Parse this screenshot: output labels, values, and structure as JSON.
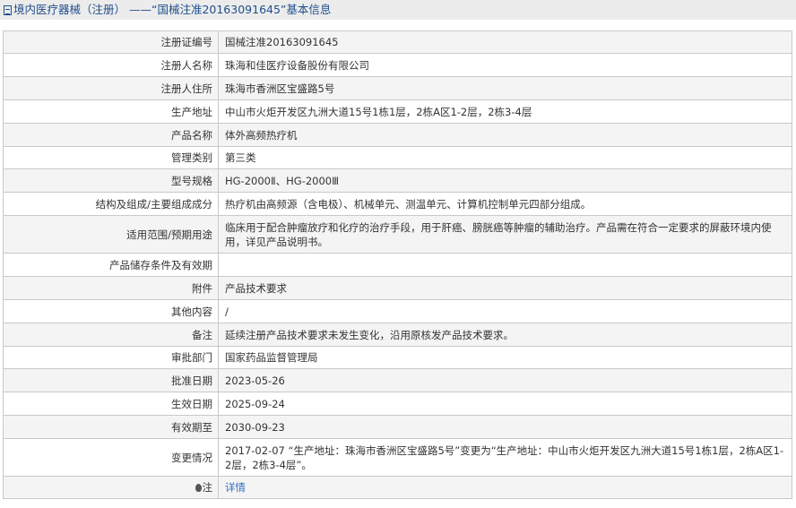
{
  "header": {
    "title": "境内医疗器械（注册）  ——“国械注准20163091645”基本信息"
  },
  "rows": [
    {
      "label": "注册证编号",
      "value": "国械注准20163091645",
      "h": 24
    },
    {
      "label": "注册人名称",
      "value": "珠海和佳医疗设备股份有限公司",
      "h": 26
    },
    {
      "label": "注册人住所",
      "value": "珠海市香洲区宝盛路5号",
      "h": 26
    },
    {
      "label": "生产地址",
      "value": "中山市火炬开发区九洲大道15号1栋1层，2栋A区1-2层，2栋3-4层",
      "h": 26
    },
    {
      "label": "产品名称",
      "value": "体外高频热疗机",
      "h": 26
    },
    {
      "label": "管理类别",
      "value": "第三类",
      "h": 24
    },
    {
      "label": "型号规格",
      "value": "HG-2000Ⅱ、HG-2000Ⅲ",
      "h": 26
    },
    {
      "label": "结构及组成/主要组成成分",
      "value": "热疗机由高频源（含电极）、机械单元、测温单元、计算机控制单元四部分组成。",
      "h": 26
    },
    {
      "label": "适用范围/预期用途",
      "value": "临床用于配合肿瘤放疗和化疗的治疗手段，用于肝癌、膀胱癌等肿瘤的辅助治疗。产品需在符合一定要求的屏蔽环境内使用，详见产品说明书。",
      "h": 42
    },
    {
      "label": "产品储存条件及有效期",
      "value": "",
      "h": 26
    },
    {
      "label": "附件",
      "value": "产品技术要求",
      "h": 26
    },
    {
      "label": "其他内容",
      "value": "/",
      "h": 26
    },
    {
      "label": "备注",
      "value": "延续注册产品技术要求未发生变化，沿用原核发产品技术要求。",
      "h": 26
    },
    {
      "label": "审批部门",
      "value": "国家药品监督管理局",
      "h": 24
    },
    {
      "label": "批准日期",
      "value": "2023-05-26",
      "h": 26
    },
    {
      "label": "生效日期",
      "value": "2025-09-24",
      "h": 26
    },
    {
      "label": "有效期至",
      "value": "2030-09-23",
      "h": 26
    },
    {
      "label": "变更情况",
      "value": "2017-02-07 “生产地址：珠海市香洲区宝盛路5号”变更为“生产地址：中山市火炬开发区九洲大道15号1栋1层，2栋A区1-2层，2栋3-4层”。",
      "h": 42
    },
    {
      "label": "注",
      "value": "详情",
      "h": 24,
      "link": true,
      "bulb": true
    }
  ]
}
